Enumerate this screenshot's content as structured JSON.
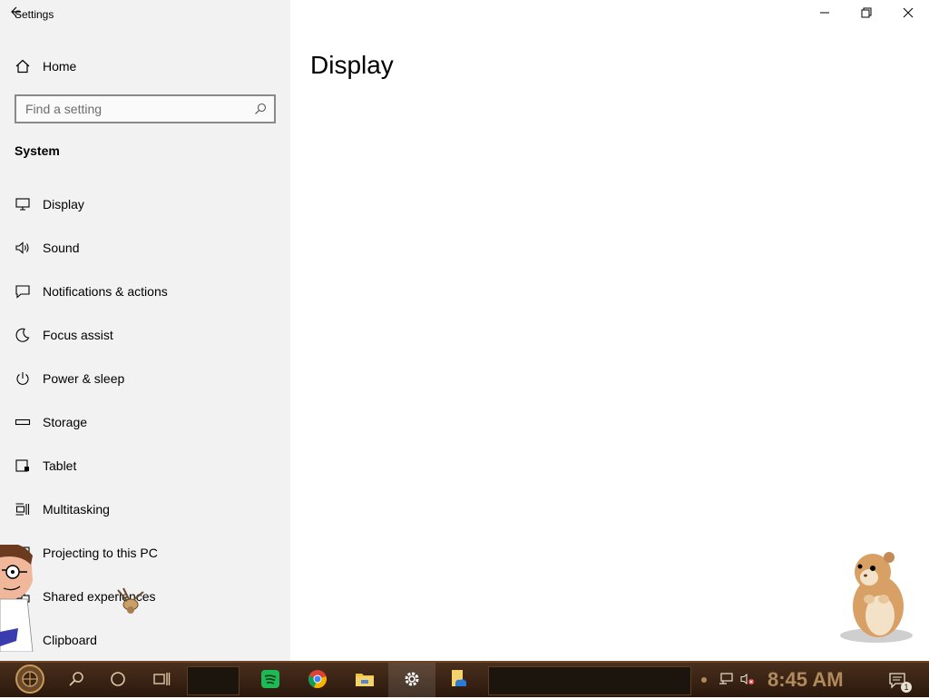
{
  "window": {
    "title": "Settings",
    "minimize_icon": "minimize-icon",
    "maximize_icon": "restore-icon",
    "close_icon": "close-icon"
  },
  "sidebar": {
    "home_label": "Home",
    "search_placeholder": "Find a setting",
    "section_title": "System",
    "items": [
      {
        "label": "Display",
        "icon": "monitor-icon"
      },
      {
        "label": "Sound",
        "icon": "speaker-icon"
      },
      {
        "label": "Notifications & actions",
        "icon": "notification-icon"
      },
      {
        "label": "Focus assist",
        "icon": "moon-icon"
      },
      {
        "label": "Power & sleep",
        "icon": "power-icon"
      },
      {
        "label": "Storage",
        "icon": "storage-icon"
      },
      {
        "label": "Tablet",
        "icon": "tablet-icon"
      },
      {
        "label": "Multitasking",
        "icon": "multitasking-icon"
      },
      {
        "label": "Projecting to this PC",
        "icon": "project-icon"
      },
      {
        "label": "Shared experiences",
        "icon": "shared-icon"
      },
      {
        "label": "Clipboard",
        "icon": "clipboard-icon"
      }
    ]
  },
  "main": {
    "title": "Display"
  },
  "taskbar": {
    "clock": "8:45 AM",
    "notification_count": "1",
    "apps": [
      "spotify-icon",
      "chrome-icon",
      "file-explorer-icon",
      "settings-gear-icon",
      "onedrive-folder-icon"
    ]
  },
  "colors": {
    "sidebar_bg": "#f2f2f2",
    "taskbar_bg": "#3a2414",
    "clock_color": "#b08a5a"
  }
}
